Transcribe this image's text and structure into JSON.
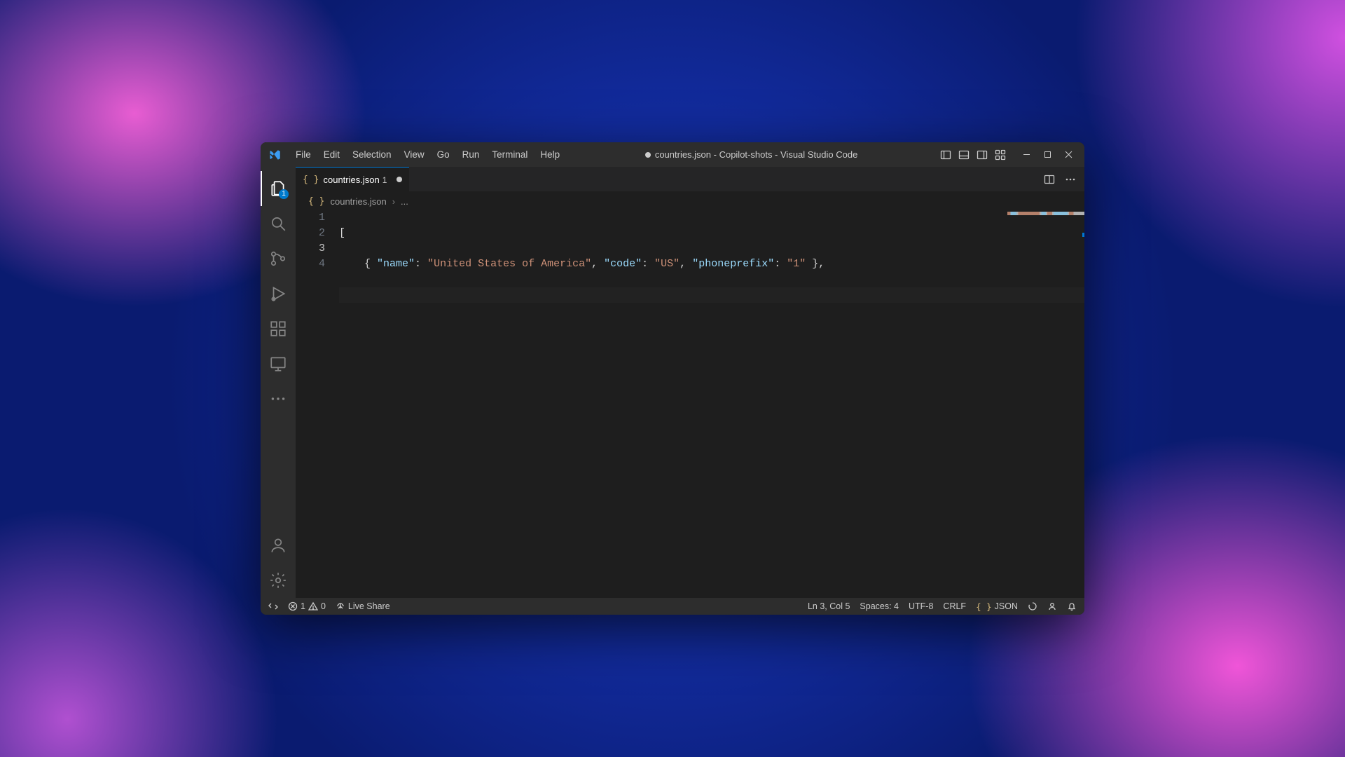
{
  "window_title": "countries.json - Copilot-shots - Visual Studio Code",
  "menu": {
    "file": "File",
    "edit": "Edit",
    "selection": "Selection",
    "view": "View",
    "go": "Go",
    "run": "Run",
    "terminal": "Terminal",
    "help": "Help"
  },
  "activitybar": {
    "explorer_badge": "1"
  },
  "tab": {
    "filename": "countries.json",
    "git_count": "1"
  },
  "breadcrumb": {
    "filename": "countries.json",
    "rest": "..."
  },
  "editor": {
    "line_numbers": [
      "1",
      "2",
      "3",
      "4"
    ],
    "current_line_index": 2,
    "line1_open": "[",
    "line2": {
      "indent": "    ",
      "open": "{ ",
      "k1": "\"name\"",
      "c1": ": ",
      "v1": "\"United States of America\"",
      "s1": ", ",
      "k2": "\"code\"",
      "c2": ": ",
      "v2": "\"US\"",
      "s2": ", ",
      "k3": "\"phoneprefix\"",
      "c3": ": ",
      "v3": "\"1\"",
      "close": " },"
    }
  },
  "status": {
    "errors": "1",
    "warnings": "0",
    "liveshare": "Live Share",
    "cursor": "Ln 3, Col 5",
    "spaces": "Spaces: 4",
    "encoding": "UTF-8",
    "eol": "CRLF",
    "lang": "JSON",
    "lang_icon": "{ }"
  }
}
